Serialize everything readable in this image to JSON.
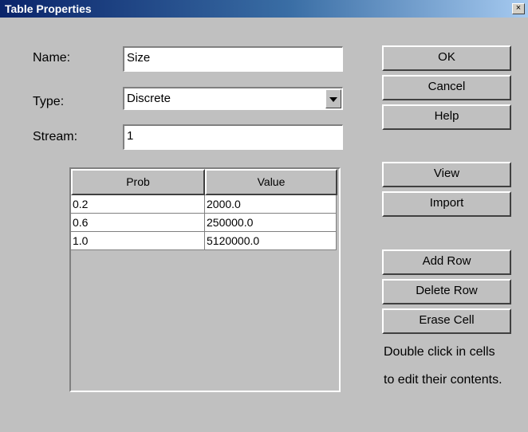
{
  "window": {
    "title": "Table Properties",
    "close_glyph": "×"
  },
  "form": {
    "name_label": "Name:",
    "name_value": "Size",
    "type_label": "Type:",
    "type_value": "Discrete",
    "stream_label": "Stream:",
    "stream_value": "1"
  },
  "table": {
    "columns": [
      "Prob",
      "Value"
    ],
    "rows": [
      [
        "0.2",
        "2000.0"
      ],
      [
        "0.6",
        "250000.0"
      ],
      [
        "1.0",
        "5120000.0"
      ]
    ]
  },
  "buttons": {
    "ok": "OK",
    "cancel": "Cancel",
    "help": "Help",
    "view": "View",
    "import": "Import",
    "add_row": "Add Row",
    "delete_row": "Delete Row",
    "erase_cell": "Erase Cell"
  },
  "hint": {
    "line1": "Double click in cells",
    "line2": "to edit their contents."
  },
  "icons": {
    "close": "close-icon",
    "dropdown": "chevron-down-icon"
  },
  "colors": {
    "titlebar_start": "#0a246a",
    "titlebar_end": "#a6caf0",
    "face": "#c0c0c0"
  }
}
